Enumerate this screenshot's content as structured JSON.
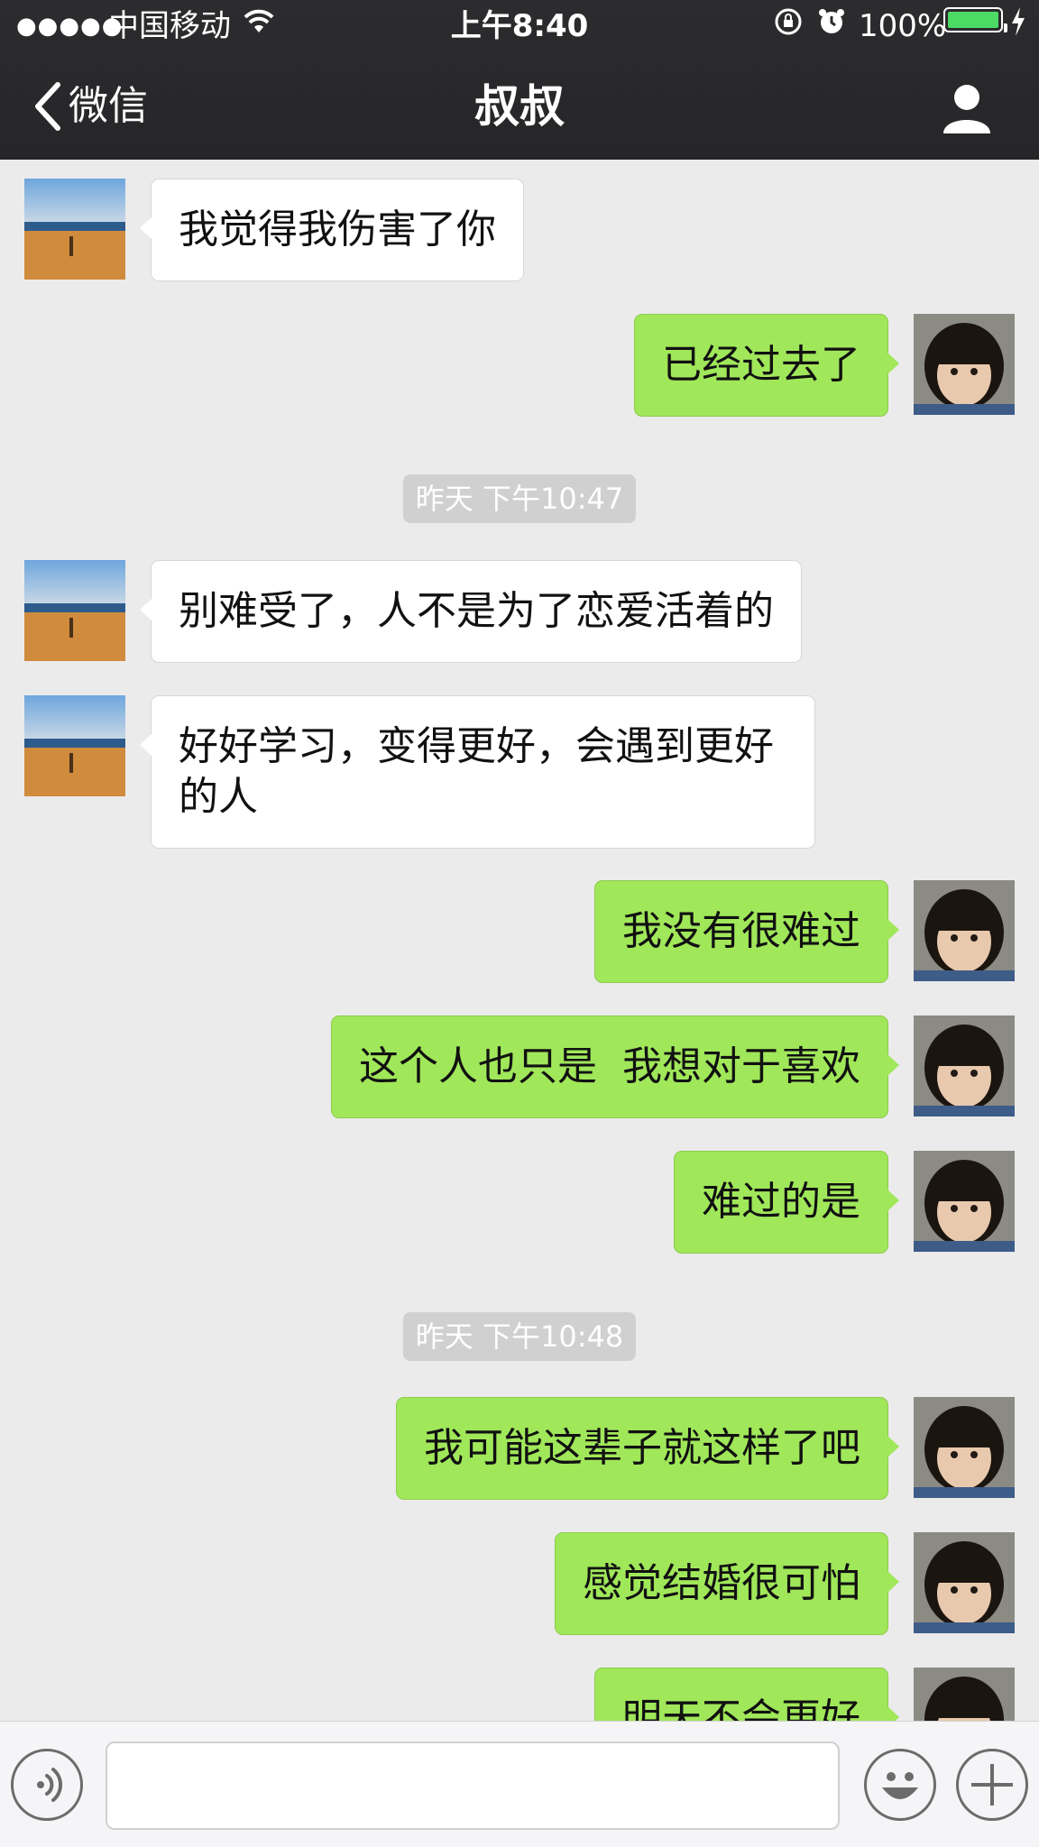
{
  "statusbar": {
    "dots": "●●●●●",
    "carrier": "中国移动",
    "time": "上午8:40",
    "battery": "100%"
  },
  "nav": {
    "back_label": "微信",
    "title": "叔叔"
  },
  "messages": [
    {
      "side": "in",
      "text": "我觉得我伤害了你"
    },
    {
      "side": "out",
      "text": "已经过去了"
    },
    {
      "type": "time",
      "text": "昨天 下午10:47"
    },
    {
      "side": "in",
      "text": "别难受了，人不是为了恋爱活着的"
    },
    {
      "side": "in",
      "text": "好好学习，变得更好，会遇到更好的人"
    },
    {
      "side": "out",
      "text": "我没有很难过"
    },
    {
      "side": "out",
      "text": "这个人也只是  我想对于喜欢"
    },
    {
      "side": "out",
      "text": "难过的是"
    },
    {
      "type": "time",
      "text": "昨天 下午10:48"
    },
    {
      "side": "out",
      "text": "我可能这辈子就这样了吧"
    },
    {
      "side": "out",
      "text": "感觉结婚很可怕"
    },
    {
      "side": "out",
      "text": "明天不会更好"
    }
  ],
  "colors": {
    "header_bg": "#2c2c2e",
    "chat_bg": "#ebebeb",
    "out_bubble": "#a0e75a",
    "in_bubble": "#ffffff",
    "battery": "#4cd964"
  },
  "icons": {
    "back": "chevron-left-icon",
    "profile": "person-icon",
    "voice": "voice-icon",
    "emoji": "emoji-icon",
    "plus": "plus-icon"
  }
}
